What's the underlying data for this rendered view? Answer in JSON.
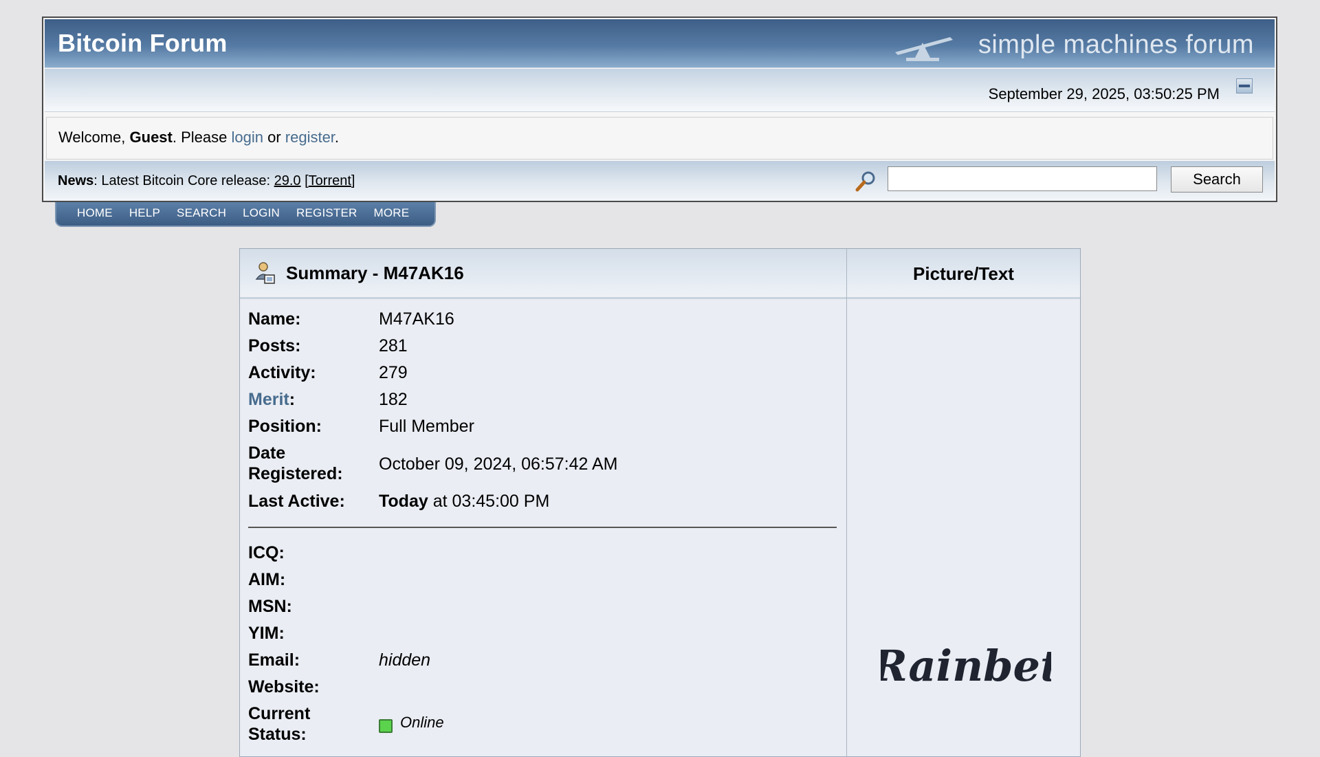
{
  "header": {
    "title": "Bitcoin Forum",
    "logo_text": "simple machines forum",
    "datetime": "September 29, 2025, 03:50:25 PM"
  },
  "welcome": {
    "prefix": "Welcome, ",
    "user": "Guest",
    "middle": ". Please ",
    "login": "login",
    "or": " or ",
    "register": "register",
    "suffix": "."
  },
  "news": {
    "label": "News",
    "text": ": Latest Bitcoin Core release: ",
    "version": "29.0",
    "open_bracket": " [",
    "torrent": "Torrent",
    "close_bracket": "]"
  },
  "search": {
    "value": "",
    "button_label": "Search"
  },
  "menu": [
    "HOME",
    "HELP",
    "SEARCH",
    "LOGIN",
    "REGISTER",
    "MORE"
  ],
  "profile": {
    "summary_title": "Summary - M47AK16",
    "picture_header": "Picture/Text",
    "fields": {
      "name_label": "Name:",
      "name": "M47AK16",
      "posts_label": "Posts:",
      "posts": "281",
      "activity_label": "Activity:",
      "activity": "279",
      "merit_label": "Merit",
      "merit_colon": ":",
      "merit": "182",
      "position_label": "Position:",
      "position": "Full Member",
      "date_label_1": "Date",
      "date_label_2": "Registered:",
      "date_registered": "October 09, 2024, 06:57:42 AM",
      "last_active_label": "Last Active:",
      "last_active_bold": "Today",
      "last_active_rest": " at 03:45:00 PM",
      "icq_label": "ICQ:",
      "aim_label": "AIM:",
      "msn_label": "MSN:",
      "yim_label": "YIM:",
      "email_label": "Email:",
      "email": "hidden",
      "website_label": "Website:",
      "status_label_1": "Current",
      "status_label_2": "Status:",
      "status": "Online"
    },
    "avatar_text": "Rainbet"
  },
  "colors": {
    "title_bar": "#3e5f87",
    "link": "#476c8e",
    "online": "#5bd34c"
  }
}
